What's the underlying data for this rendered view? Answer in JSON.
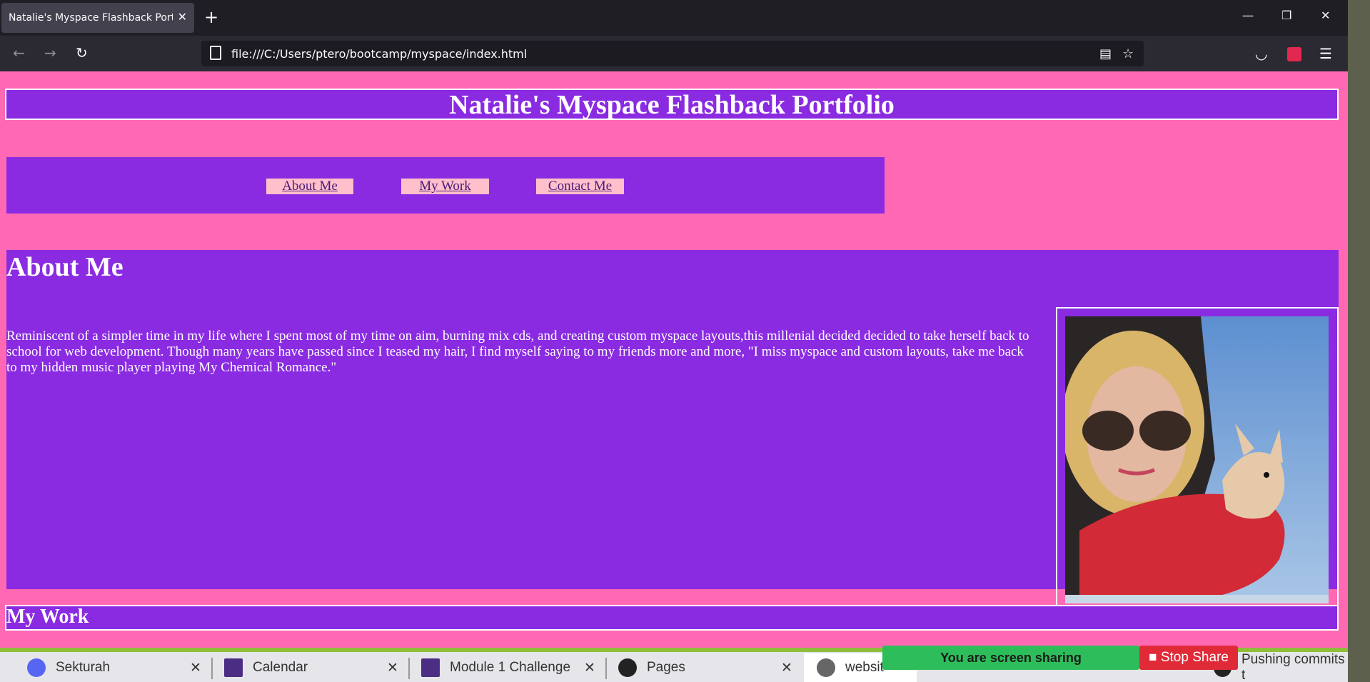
{
  "browser": {
    "tab_title": "Natalie's Myspace Flashback Portfolio",
    "url": "file:///C:/Users/ptero/bootcamp/myspace/index.html"
  },
  "page": {
    "title": "Natalie's Myspace Flashback Portfolio",
    "nav": [
      {
        "label": "About Me"
      },
      {
        "label": "My Work"
      },
      {
        "label": "Contact Me"
      }
    ],
    "about": {
      "heading": "About Me",
      "text": "Reminiscent of a simpler time in my life where I spent most of my time on aim, burning mix cds, and creating custom myspace layouts,this millenial decided decided to take herself back to school for web development. Though many years have passed since I teased my hair, I find myself saying to my friends more and more, \"I miss myspace and custom layouts, take me back to my hidden music player playing My Chemical Romance.\""
    },
    "mywork_heading": "My Work"
  },
  "taskbar": {
    "tabs": [
      {
        "label": "Sekturah",
        "icon": "discord-icon"
      },
      {
        "label": "Calendar",
        "icon": "w-icon"
      },
      {
        "label": "Module 1 Challenge",
        "icon": "w-icon"
      },
      {
        "label": "Pages",
        "icon": "github-icon"
      },
      {
        "label": "websit",
        "icon": "globe-icon"
      },
      {
        "label": "Pushing commits t",
        "icon": "github-icon"
      }
    ],
    "screen_share": "You are screen sharing",
    "stop_share": "Stop Share"
  },
  "colors": {
    "page_bg": "#ff69b4",
    "panel": "#8a2be2",
    "nav_button": "#ffc0cb"
  }
}
